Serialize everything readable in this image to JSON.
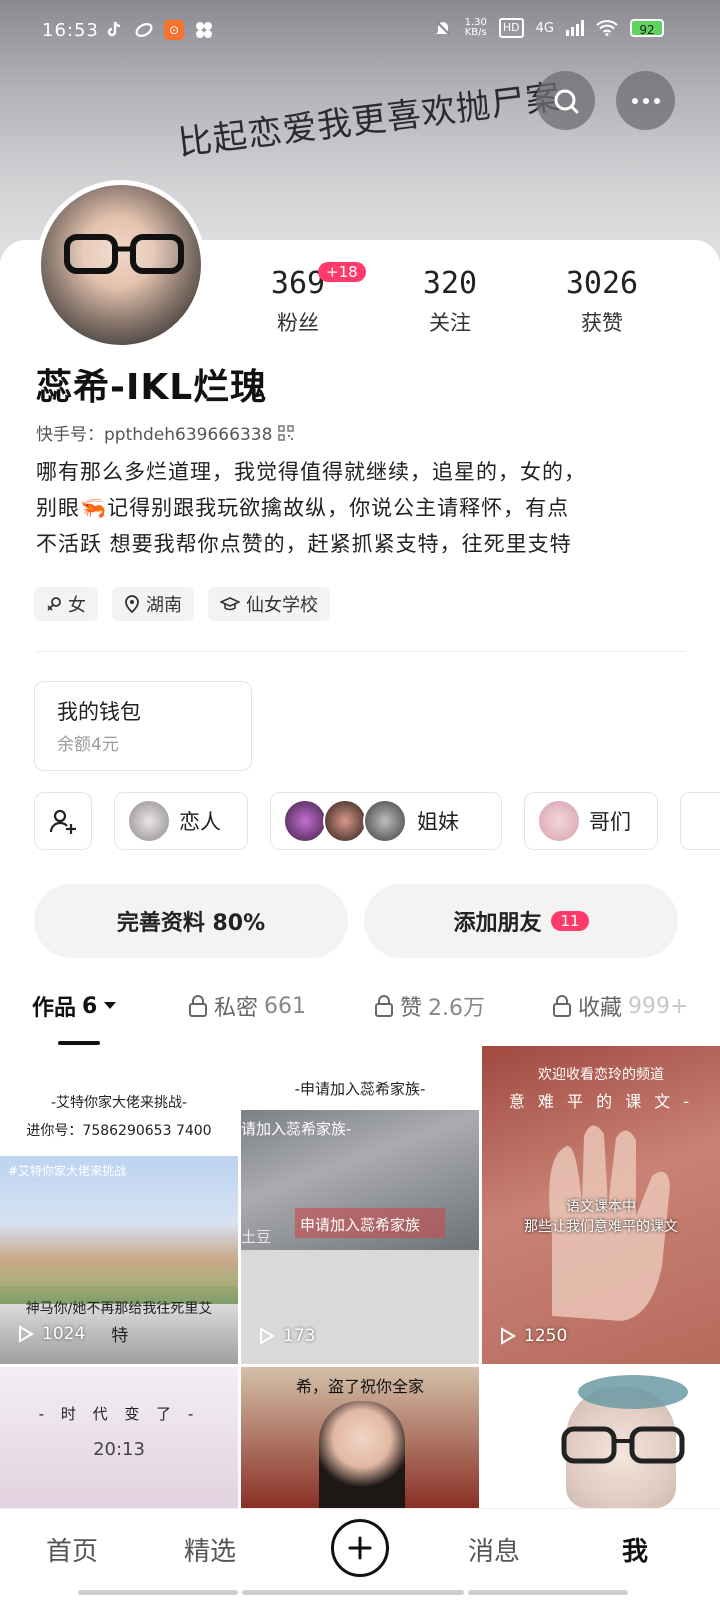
{
  "status_bar": {
    "time": "16:53",
    "net_speed_value": "1.30",
    "net_speed_unit": "KB/s",
    "hd": "HD",
    "signal": "4G",
    "battery": "92"
  },
  "banner": {
    "text": "比起恋爱我更喜欢抛尸案"
  },
  "profile": {
    "stats": [
      {
        "value": "369",
        "label": "粉丝"
      },
      {
        "value": "320",
        "label": "关注"
      },
      {
        "value": "3026",
        "label": "获赞"
      }
    ],
    "new_followers_badge": "+18",
    "username": "蕊希-IKL烂瑰",
    "kuaishou_id": "快手号：ppthdeh639666338",
    "bio_lines": [
      "哪有那么多烂道理，我觉得值得就继续，追星的，女的，",
      "别眼🦐记得别跟我玩欲擒故纵，你说公主请释怀，有点",
      "不活跃 想要我帮你点赞的，赶紧抓紧支特，往死里支特"
    ],
    "tags": [
      "女",
      "湖南",
      "仙女学校"
    ]
  },
  "wallet": {
    "title": "我的钱包",
    "balance": "余额4元"
  },
  "friends": [
    {
      "label": "恋人"
    },
    {
      "label": "姐妹"
    },
    {
      "label": "哥们"
    }
  ],
  "actions": {
    "complete_profile": "完善资料 80%",
    "add_friends": "添加朋友",
    "add_friends_badge": "11"
  },
  "tabs": [
    {
      "label": "作品",
      "count": "6"
    },
    {
      "label": "私密",
      "count": "661"
    },
    {
      "label": "赞",
      "count": "2.6万"
    },
    {
      "label": "收藏",
      "count": "999+"
    }
  ],
  "videos": [
    {
      "top_text": "-艾特你家大佬来挑战-",
      "sub_text": "进你号：7586290653 7400",
      "inner_caption": "#艾特你家大佬来挑战",
      "bottom_text": "神马你/她不再那给我往死里艾",
      "plays": "1024",
      "extra": "特"
    },
    {
      "top_text": "-申请加入蕊希家族-",
      "inner_caption": "请加入蕊希家族-",
      "mid_caption": "申请加入蕊希家族",
      "corner_text": "土豆",
      "plays": "173"
    },
    {
      "top_text": "欢迎收看恋玲的频道",
      "sub_text": "意 难 平 的 课 文 -",
      "inner_caption": "语文课本中",
      "mid_caption": "那些让我们意难平的课文",
      "plays": "1250"
    },
    {
      "top_text": "- 时 代 变 了 -",
      "clock": "20:13"
    },
    {
      "top_text": "希，盗了祝你全家"
    },
    {
      "top_text": ""
    }
  ],
  "bottom_nav": {
    "items": [
      "首页",
      "精选",
      "消息",
      "我"
    ]
  }
}
